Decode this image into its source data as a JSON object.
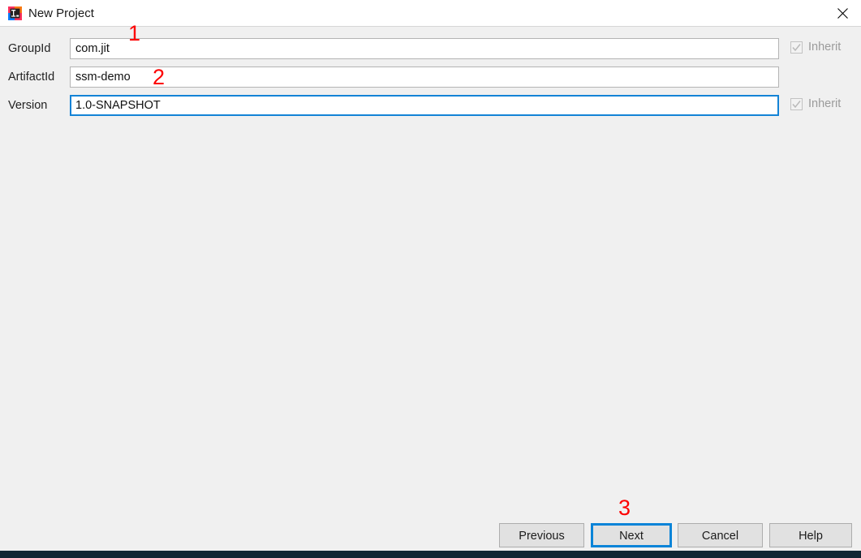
{
  "window": {
    "title": "New Project",
    "app_icon": "intellij-idea-icon",
    "close_icon": "close-icon"
  },
  "form": {
    "rows": [
      {
        "label": "GroupId",
        "value": "com.jit",
        "focused": false,
        "inherit": {
          "label": "Inherit",
          "checked": true,
          "enabled": false
        }
      },
      {
        "label": "ArtifactId",
        "value": "ssm-demo",
        "focused": false,
        "inherit": null
      },
      {
        "label": "Version",
        "value": "1.0-SNAPSHOT",
        "focused": true,
        "inherit": {
          "label": "Inherit",
          "checked": true,
          "enabled": false
        }
      }
    ]
  },
  "annotations": [
    {
      "text": "1",
      "color": "#fd0000"
    },
    {
      "text": "2",
      "color": "#fd0000"
    },
    {
      "text": "3",
      "color": "#fd0000"
    }
  ],
  "buttons": {
    "previous": "Previous",
    "next": "Next",
    "cancel": "Cancel",
    "help": "Help"
  },
  "colors": {
    "focus_blue": "#0a84d8",
    "field_border": "#b4b4b4",
    "body_background": "#f0f0f0",
    "titlebar_background": "#ffffff",
    "button_face": "#e1e1e1",
    "annotation_red": "#fd0000",
    "bottom_strip": "#122733"
  }
}
